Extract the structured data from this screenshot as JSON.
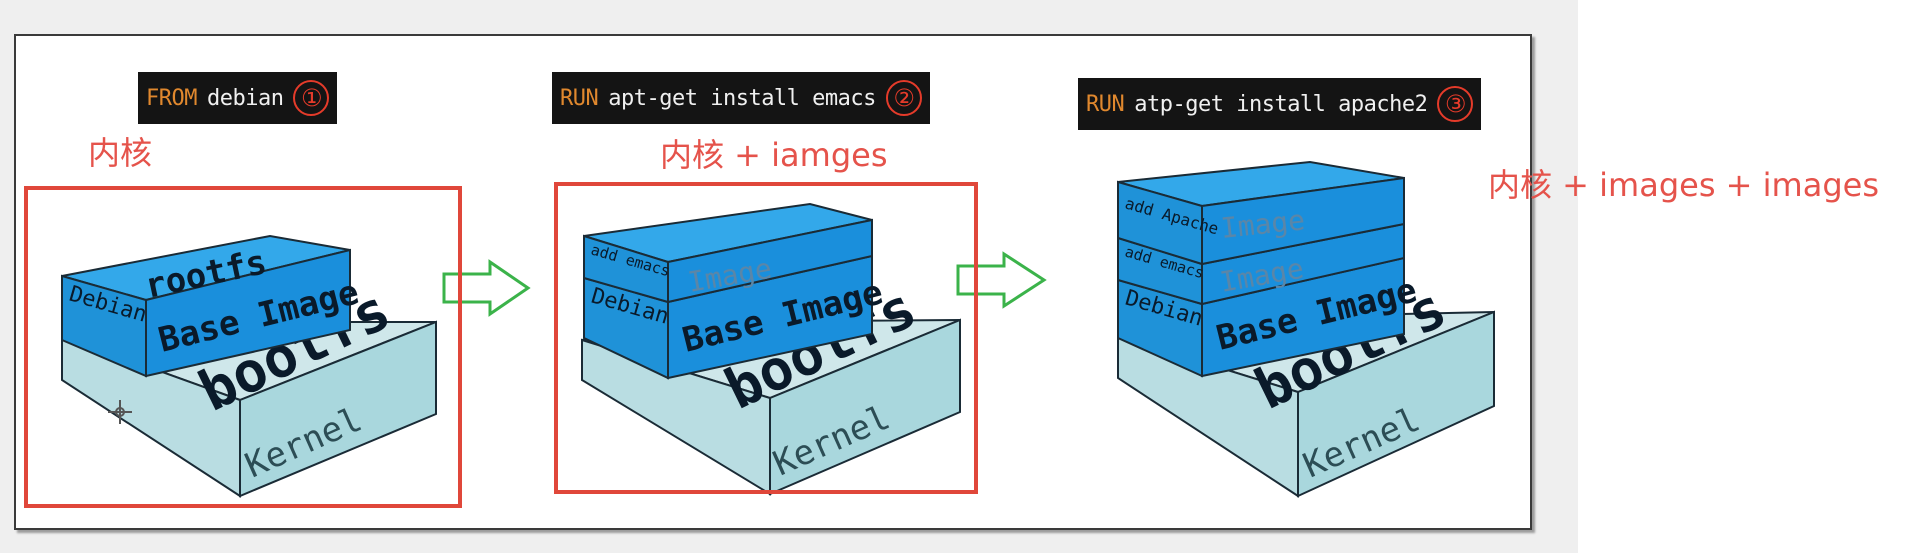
{
  "steps": [
    {
      "keyword": "FROM",
      "args": "debian",
      "number": "①"
    },
    {
      "keyword": "RUN",
      "args": "apt-get install emacs",
      "number": "②"
    },
    {
      "keyword": "RUN",
      "args": "atp-get install apache2",
      "number": "③"
    }
  ],
  "notes": [
    "内核",
    "内核 + iamges",
    "内核 + images  + images"
  ],
  "layers": {
    "rootfs": "rootfs",
    "debian": "Debian",
    "base_image": "Base Image",
    "bootfs": "bootfs",
    "kernel": "Kernel",
    "add_emacs": "add emacs",
    "add_apache": "add Apache",
    "image": "Image"
  },
  "colors": {
    "layer_blue": "#1a8fdc",
    "layer_blue_top": "#33a8ea",
    "kernel_face": "#a9d7dd",
    "arrow_green": "#3bb34a",
    "highlight_red": "#e0473a"
  },
  "icons": [
    "arrow-right-icon",
    "arrow-right-icon",
    "crosshair-cursor-icon"
  ]
}
